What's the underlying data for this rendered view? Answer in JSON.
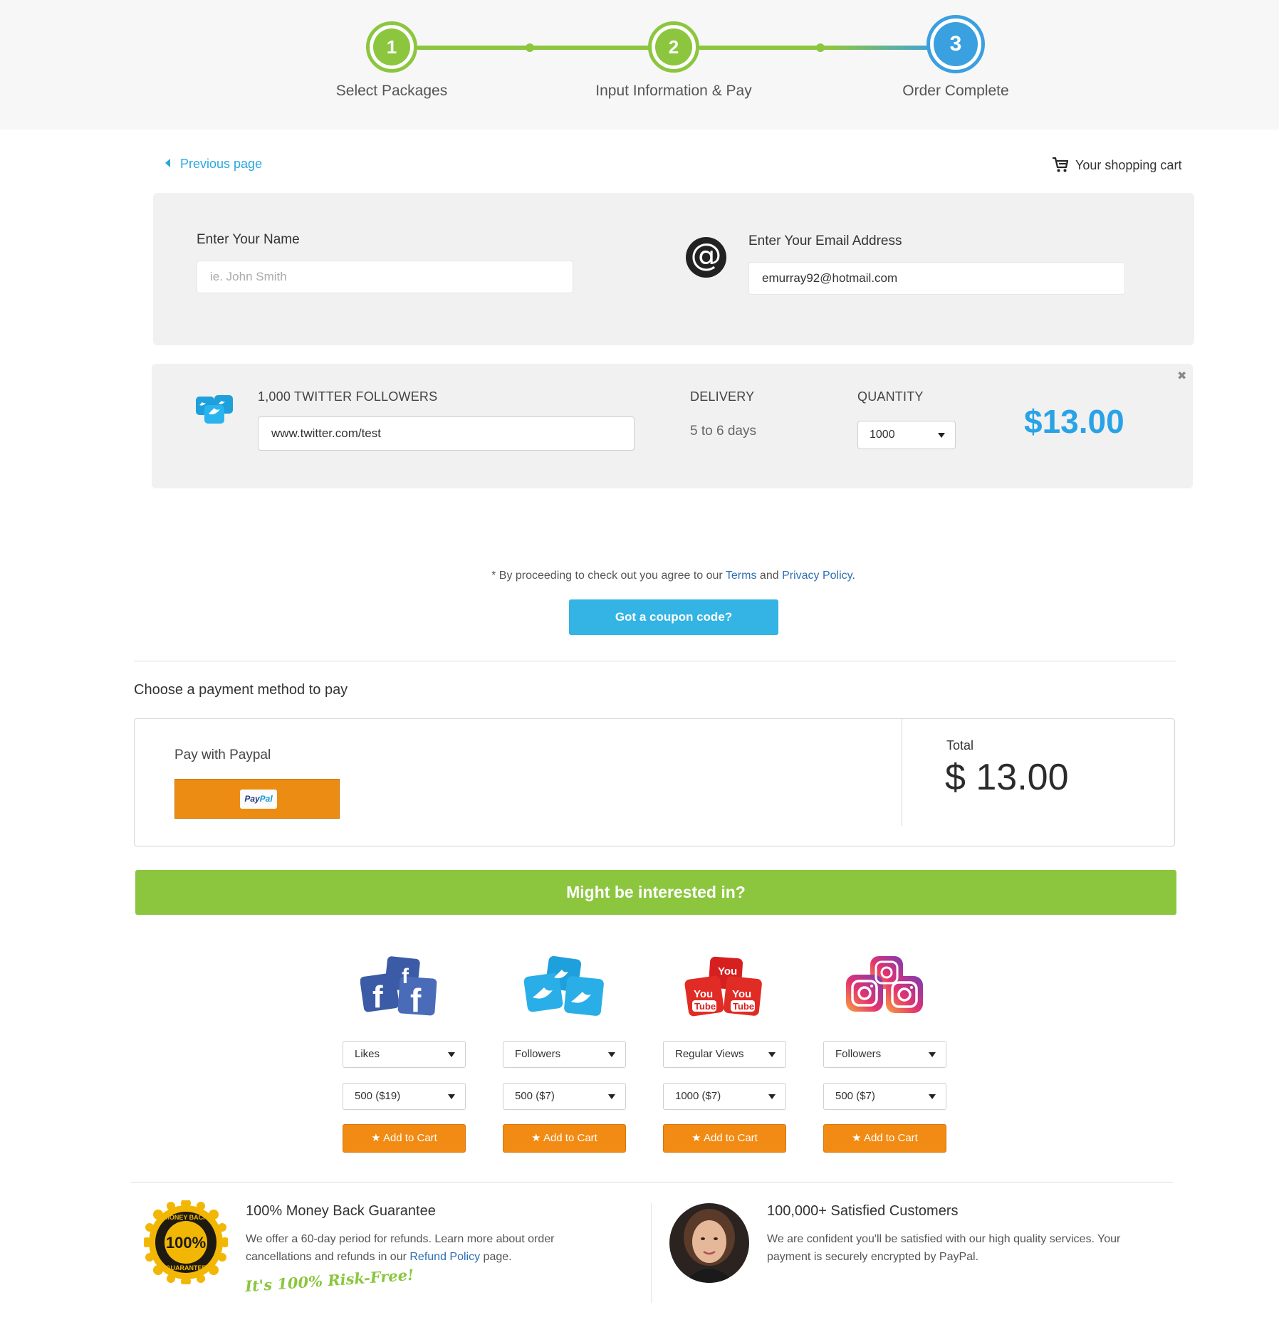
{
  "steps": [
    {
      "number": "1",
      "label": "Select Packages"
    },
    {
      "number": "2",
      "label": "Input Information & Pay"
    },
    {
      "number": "3",
      "label": "Order Complete"
    }
  ],
  "nav": {
    "previous_label": "Previous page",
    "cart_label": "Your shopping cart"
  },
  "form": {
    "name_label": "Enter Your Name",
    "name_placeholder": "ie. John Smith",
    "name_value": "",
    "email_label": "Enter Your Email Address",
    "email_value": "emurray92@hotmail.com"
  },
  "order_item": {
    "title": "1,000 TWITTER FOLLOWERS",
    "url_value": "www.twitter.com/test",
    "delivery_label": "DELIVERY",
    "delivery_value": "5 to 6 days",
    "quantity_label": "QUANTITY",
    "quantity_value": "1000",
    "price": "$13.00",
    "remove_symbol": "✖"
  },
  "terms": {
    "prefix": "* By proceeding to check out you agree to our ",
    "terms_link": "Terms",
    "middle": " and ",
    "privacy_link": "Privacy Policy",
    "suffix": "."
  },
  "coupon_button": "Got a coupon code?",
  "payment": {
    "section_title": "Choose a payment method to pay",
    "paypal_label": "Pay with Paypal",
    "paypal_logo_a": "Pay",
    "paypal_logo_b": "Pal",
    "total_label": "Total",
    "total_value": "$ 13.00"
  },
  "interested_banner": "Might be interested in?",
  "products": [
    {
      "icon": "facebook-icon",
      "service": "Likes",
      "package": "500 ($19)",
      "button": "Add to Cart"
    },
    {
      "icon": "twitter-icon",
      "service": "Followers",
      "package": "500 ($7)",
      "button": "Add to Cart"
    },
    {
      "icon": "youtube-icon",
      "service": "Regular Views",
      "package": "1000 ($7)",
      "button": "Add to Cart"
    },
    {
      "icon": "instagram-icon",
      "service": "Followers",
      "package": "500 ($7)",
      "button": "Add to Cart"
    }
  ],
  "guarantee": {
    "badge_top": "MONEY BACK",
    "badge_center": "100%",
    "badge_bottom": "GUARANTEE",
    "title": "100% Money Back Guarantee",
    "text_prefix": "We offer a 60-day period for refunds. Learn more about order cancellations and refunds in our ",
    "refund_link": "Refund Policy",
    "text_suffix": " page.",
    "tagline": "It's 100% Risk-Free!"
  },
  "customers": {
    "title": "100,000+ Satisfied Customers",
    "text": "We are confident you'll be satisfied with our high quality services. Your payment is securely encrypted by PayPal."
  },
  "colors": {
    "green": "#8cc63f",
    "blue": "#3aa0e0",
    "price_blue": "#29a3e6",
    "orange": "#f18b14",
    "link": "#2f6fb3"
  }
}
